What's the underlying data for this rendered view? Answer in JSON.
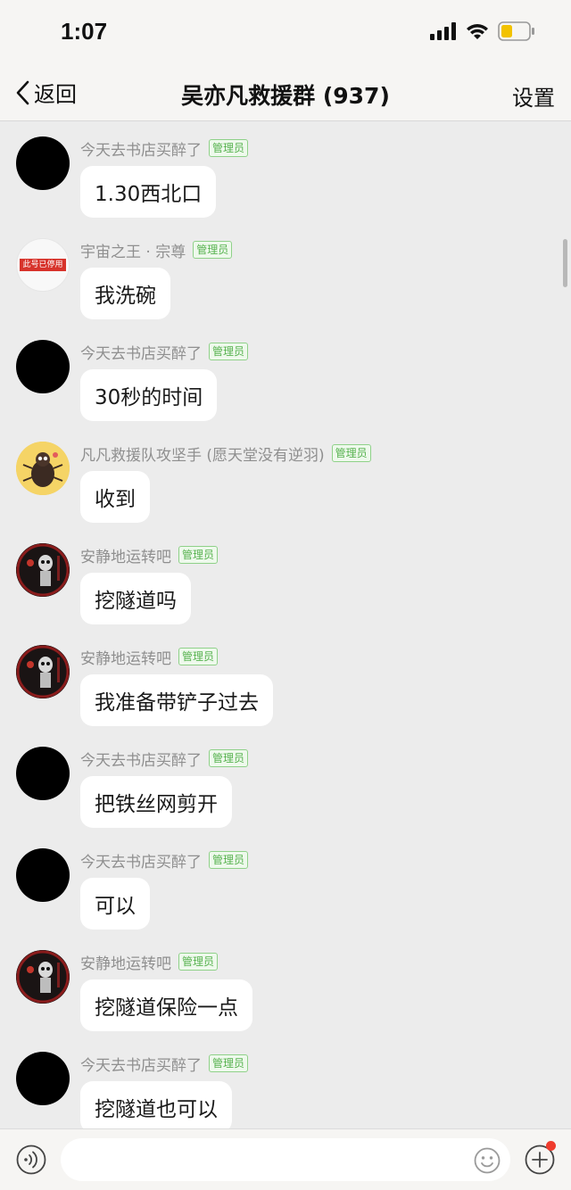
{
  "status_bar": {
    "time": "1:07",
    "icons": [
      "signal-icon",
      "wifi-icon",
      "battery-icon"
    ]
  },
  "nav": {
    "back_label": "返回",
    "title": "吴亦凡救援群 (937)",
    "settings_label": "设置"
  },
  "badge_label": "管理员",
  "disabled_avatar_text": "此号已停用",
  "colors": {
    "admin_badge": "#57b24f",
    "background": "#ececec",
    "bubble": "#ffffff",
    "notification_dot": "#ef3b2d"
  },
  "messages": [
    {
      "sender": "今天去书店买醉了",
      "text": "1.30西北口",
      "avatar": "black"
    },
    {
      "sender": "宇宙之王 · 宗尊",
      "text": "我洗碗",
      "avatar": "disabled"
    },
    {
      "sender": "今天去书店买醉了",
      "text": "30秒的时间",
      "avatar": "black"
    },
    {
      "sender": "凡凡救援队攻坚手 (愿天堂没有逆羽)",
      "text": "收到",
      "avatar": "beetle"
    },
    {
      "sender": "安静地运转吧",
      "text": "挖隧道吗",
      "avatar": "skeleton"
    },
    {
      "sender": "安静地运转吧",
      "text": "我准备带铲子过去",
      "avatar": "skeleton"
    },
    {
      "sender": "今天去书店买醉了",
      "text": "把铁丝网剪开",
      "avatar": "black"
    },
    {
      "sender": "今天去书店买醉了",
      "text": "可以",
      "avatar": "black"
    },
    {
      "sender": "安静地运转吧",
      "text": "挖隧道保险一点",
      "avatar": "skeleton"
    },
    {
      "sender": "今天去书店买醉了",
      "text": "挖隧道也可以",
      "avatar": "black"
    }
  ],
  "input": {
    "placeholder": "",
    "value": ""
  }
}
